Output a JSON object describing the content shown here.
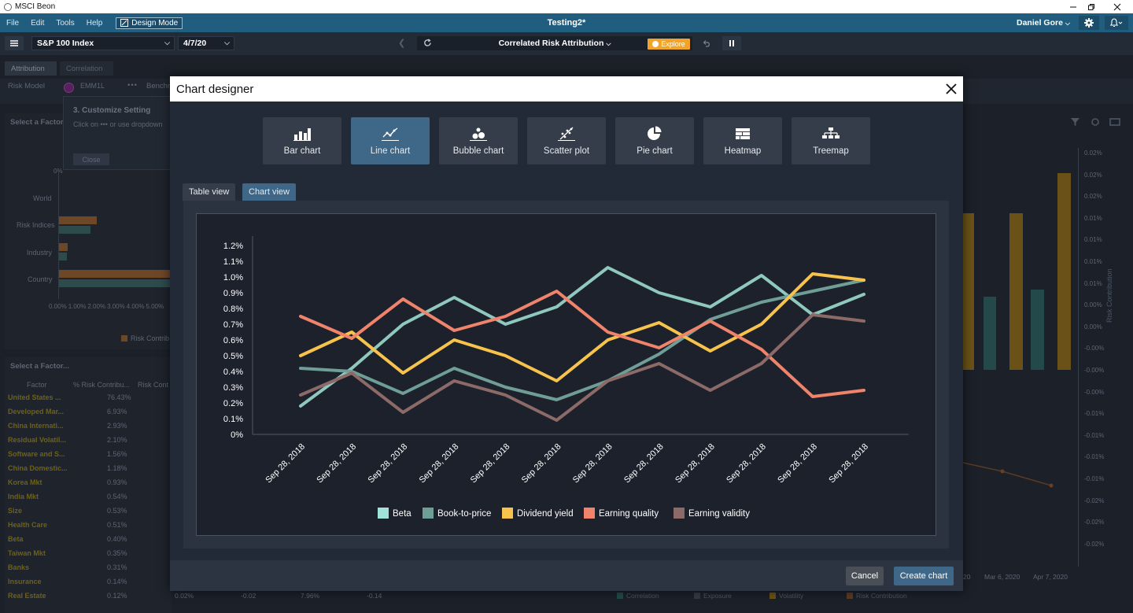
{
  "window": {
    "app_title": "MSCI Beon"
  },
  "menu": {
    "items": [
      "File",
      "Edit",
      "Tools",
      "Help"
    ],
    "design_mode": "Design Mode",
    "doc_title": "Testing2*",
    "user": "Daniel Gore"
  },
  "toolbar": {
    "portfolio": "S&P 100 Index",
    "date": "4/7/20",
    "analysis": "Correlated Risk Attribution",
    "explore": "Explore"
  },
  "background": {
    "tabs": [
      "Attribution",
      "Correlation"
    ],
    "risk_model_label": "Risk Model",
    "risk_model_value": "EMM1L",
    "benchmark_label": "Benchm",
    "select_factor": "Select a Factor",
    "customize_title": "3. Customize Setting",
    "customize_text": "Click on ••• or use dropdown",
    "close_btn": "Close",
    "bar_labels": [
      "World",
      "Risk Indices",
      "Industry",
      "Country"
    ],
    "x_ticks": [
      "0.00%",
      "1.00%",
      "2.00%",
      "3.00%",
      "4.00%",
      "5.00%"
    ],
    "zero_tick": "0%",
    "legend_risk": "Risk Contrib",
    "select_factor2": "Select a Factor...",
    "table_headers": [
      "Factor",
      "% Risk Contribu...",
      "Risk Cont"
    ],
    "table_rows": [
      {
        "factor": "United States ...",
        "pct": "76.43%"
      },
      {
        "factor": "Developed Mar...",
        "pct": "6.93%"
      },
      {
        "factor": "China Internati...",
        "pct": "2.93%"
      },
      {
        "factor": "Residual Volatil...",
        "pct": "2.10%"
      },
      {
        "factor": "Software and S...",
        "pct": "1.56%"
      },
      {
        "factor": "China Domestic...",
        "pct": "1.18%"
      },
      {
        "factor": "Korea Mkt",
        "pct": "0.93%"
      },
      {
        "factor": "India Mkt",
        "pct": "0.54%"
      },
      {
        "factor": "Size",
        "pct": "0.53%"
      },
      {
        "factor": "Health Care",
        "pct": "0.51%"
      },
      {
        "factor": "Beta",
        "pct": "0.40%"
      },
      {
        "factor": "Taiwan Mkt",
        "pct": "0.35%"
      },
      {
        "factor": "Banks",
        "pct": "0.31%"
      },
      {
        "factor": "Insurance",
        "pct": "0.14%"
      },
      {
        "factor": "Real Estate",
        "pct": "0.12%"
      }
    ],
    "bottom_row_values": [
      "0.02%",
      "-0.02",
      "7.96%",
      "-0.14"
    ],
    "right_y_ticks": [
      "0.02%",
      "0.02%",
      "0.02%",
      "0.01%",
      "0.01%",
      "0.01%",
      "0.01%",
      "0.00%",
      "0.00%",
      "-0.00%",
      "-0.00%",
      "-0.00%",
      "-0.01%",
      "-0.01%",
      "-0.01%",
      "-0.01%",
      "-0.02%",
      "-0.02%",
      "-0.02%"
    ],
    "right_y_label": "Risk Contribution",
    "right_x_ticks": [
      "20",
      "Mar 6, 2020",
      "Apr 7, 2020"
    ],
    "bottom_legend": [
      "Correlation",
      "Exposure",
      "Volatility",
      "Risk Contribution"
    ]
  },
  "modal": {
    "title": "Chart designer",
    "chart_types": [
      {
        "label": "Bar chart",
        "icon": "bar-chart-icon"
      },
      {
        "label": "Line chart",
        "icon": "line-chart-icon"
      },
      {
        "label": "Bubble chart",
        "icon": "bubble-chart-icon"
      },
      {
        "label": "Scatter plot",
        "icon": "scatter-plot-icon"
      },
      {
        "label": "Pie chart",
        "icon": "pie-chart-icon"
      },
      {
        "label": "Heatmap",
        "icon": "heatmap-icon"
      },
      {
        "label": "Treemap",
        "icon": "treemap-icon"
      }
    ],
    "active_chart_type": "Line chart",
    "view_tabs": [
      "Table view",
      "Chart view"
    ],
    "active_view": "Chart view",
    "cancel": "Cancel",
    "create": "Create chart"
  },
  "chart_data": {
    "type": "line",
    "x": [
      "Sep 28, 2018",
      "Sep 28, 2018",
      "Sep 28, 2018",
      "Sep 28, 2018",
      "Sep 28, 2018",
      "Sep 28, 2018",
      "Sep 28, 2018",
      "Sep 28, 2018",
      "Sep 28, 2018",
      "Sep 28, 2018",
      "Sep 28, 2018",
      "Sep 28, 2018"
    ],
    "y_ticks": [
      "0%",
      "0.1%",
      "0.2%",
      "0.3%",
      "0.4%",
      "0.5%",
      "0.6%",
      "0.7%",
      "0.8%",
      "0.9%",
      "1.0%",
      "1.1%",
      "1.2%"
    ],
    "ylim": [
      0,
      1.2
    ],
    "legend_position": "bottom",
    "series": [
      {
        "name": "Beta",
        "color": "#8fc9be",
        "values": [
          0.18,
          0.42,
          0.7,
          0.87,
          0.7,
          0.81,
          1.06,
          0.9,
          0.81,
          1.01,
          0.76,
          0.89
        ]
      },
      {
        "name": "Book-to-price",
        "color": "#6f9e96",
        "values": [
          0.42,
          0.4,
          0.26,
          0.42,
          0.3,
          0.22,
          0.34,
          0.51,
          0.73,
          0.84,
          0.91,
          0.98
        ]
      },
      {
        "name": "Dividend yield",
        "color": "#f7c34c",
        "values": [
          0.5,
          0.65,
          0.39,
          0.6,
          0.5,
          0.34,
          0.6,
          0.71,
          0.53,
          0.7,
          1.02,
          0.98
        ]
      },
      {
        "name": "Earning quality",
        "color": "#f0836b",
        "values": [
          0.75,
          0.61,
          0.86,
          0.66,
          0.75,
          0.91,
          0.65,
          0.55,
          0.72,
          0.54,
          0.24,
          0.28
        ]
      },
      {
        "name": "Earning validity",
        "color": "#8c6a67",
        "values": [
          0.25,
          0.39,
          0.14,
          0.34,
          0.25,
          0.09,
          0.34,
          0.45,
          0.28,
          0.45,
          0.76,
          0.72
        ]
      }
    ],
    "legend_swatches": [
      "#9fe3da",
      "#6f9e96",
      "#f7c34c",
      "#f0836b",
      "#8c6a67"
    ]
  }
}
